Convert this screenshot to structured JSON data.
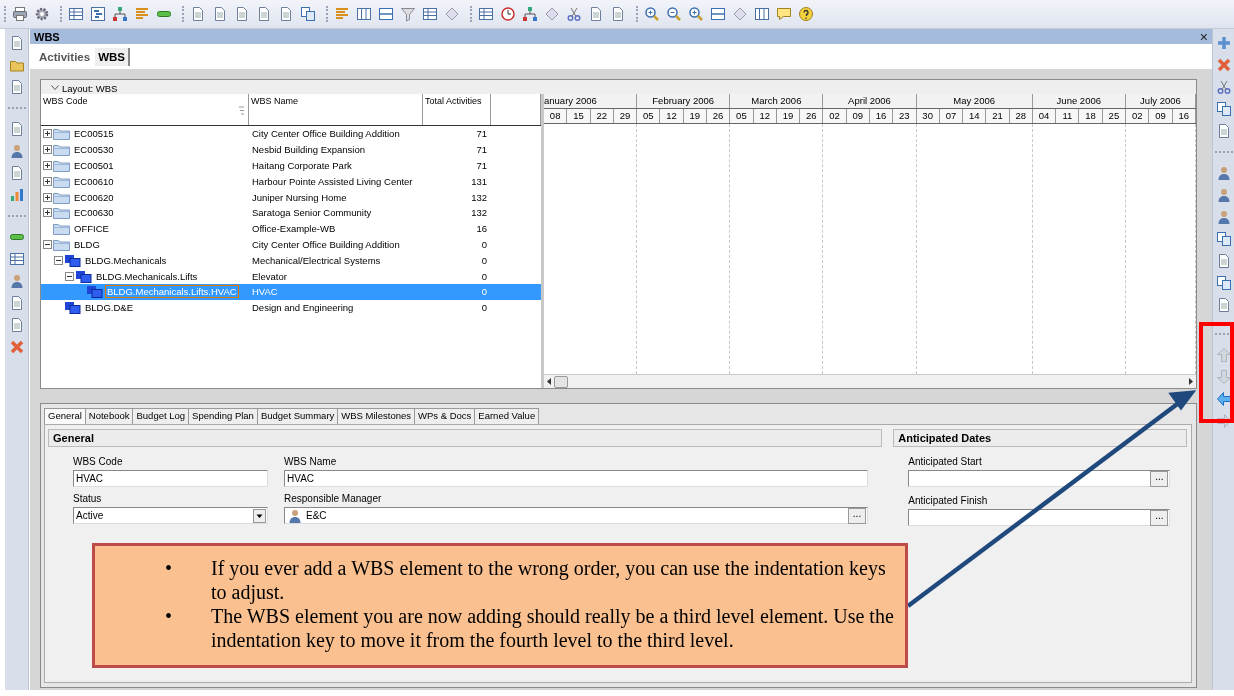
{
  "window": {
    "title": "WBS",
    "close_label": "×"
  },
  "view_tabs": [
    {
      "label": "Activities",
      "selected": false
    },
    {
      "label": "WBS",
      "selected": true
    }
  ],
  "layout": {
    "label": "Layout: WBS"
  },
  "table": {
    "columns": [
      "WBS Code",
      "WBS Name",
      "Total Activities"
    ],
    "rows": [
      {
        "code": "EC00515",
        "name": "City Center Office Building Addition",
        "total": "71",
        "kind": "folder",
        "expanded": false,
        "selected": false
      },
      {
        "code": "EC00530",
        "name": "Nesbid Building Expansion",
        "total": "71",
        "kind": "folder",
        "expanded": false,
        "selected": false
      },
      {
        "code": "EC00501",
        "name": "Haitang Corporate Park",
        "total": "71",
        "kind": "folder",
        "expanded": false,
        "selected": false
      },
      {
        "code": "EC00610",
        "name": "Harbour Pointe Assisted Living Center",
        "total": "131",
        "kind": "folder",
        "expanded": false,
        "selected": false
      },
      {
        "code": "EC00620",
        "name": "Juniper Nursing Home",
        "total": "132",
        "kind": "folder",
        "expanded": false,
        "selected": false
      },
      {
        "code": "EC00630",
        "name": "Saratoga Senior Community",
        "total": "132",
        "kind": "folder",
        "expanded": false,
        "selected": false
      },
      {
        "code": "OFFICE",
        "name": "Office-Example-WB",
        "total": "16",
        "kind": "folder",
        "selected": false
      },
      {
        "code": "BLDG",
        "name": "City Center Office Building Addition",
        "total": "0",
        "kind": "folder",
        "expanded": true,
        "selected": false,
        "children": [
          {
            "code": "BLDG.Mechanicals",
            "name": "Mechanical/Electrical Systems",
            "total": "0",
            "kind": "wbs",
            "expanded": true,
            "selected": false,
            "children": [
              {
                "code": "BLDG.Mechanicals.Lifts",
                "name": "Elevator",
                "total": "0",
                "kind": "wbs",
                "expanded": true,
                "selected": false,
                "children": [
                  {
                    "code": "BLDG.Mechanicals.Lifts.HVAC",
                    "name": "HVAC",
                    "total": "0",
                    "kind": "wbs",
                    "selected": true
                  }
                ]
              }
            ]
          },
          {
            "code": "BLDG.D&E",
            "name": "Design and Engineering",
            "total": "0",
            "kind": "wbs",
            "selected": false
          }
        ]
      }
    ]
  },
  "gantt": {
    "months": [
      {
        "label": "anuary 2006",
        "weeks": [
          "08",
          "15",
          "22",
          "29"
        ]
      },
      {
        "label": "February 2006",
        "weeks": [
          "05",
          "12",
          "19",
          "26"
        ]
      },
      {
        "label": "March 2006",
        "weeks": [
          "05",
          "12",
          "19",
          "26"
        ]
      },
      {
        "label": "April 2006",
        "weeks": [
          "02",
          "09",
          "16",
          "23"
        ]
      },
      {
        "label": "May 2006",
        "weeks": [
          "30",
          "07",
          "14",
          "21",
          "28"
        ]
      },
      {
        "label": "June 2006",
        "weeks": [
          "04",
          "11",
          "18",
          "25"
        ]
      },
      {
        "label": "July 2006",
        "weeks": [
          "02",
          "09",
          "16"
        ]
      }
    ]
  },
  "detail_tabs": [
    {
      "label": "General",
      "selected": true
    },
    {
      "label": "Notebook",
      "selected": false
    },
    {
      "label": "Budget Log",
      "selected": false
    },
    {
      "label": "Spending Plan",
      "selected": false
    },
    {
      "label": "Budget Summary",
      "selected": false
    },
    {
      "label": "WBS Milestones",
      "selected": false
    },
    {
      "label": "WPs & Docs",
      "selected": false
    },
    {
      "label": "Earned Value",
      "selected": false
    }
  ],
  "general": {
    "title": "General",
    "fields": [
      {
        "label": "WBS Code",
        "value": "HVAC",
        "kind": "text"
      },
      {
        "label": "WBS Name",
        "value": "HVAC",
        "kind": "text"
      },
      {
        "label": "Status",
        "value": "Active",
        "kind": "dropdown"
      },
      {
        "label": "Responsible Manager",
        "value": "E&C",
        "kind": "picker",
        "button": "..."
      }
    ]
  },
  "anticipated_dates": {
    "title": "Anticipated Dates",
    "fields": [
      {
        "label": "Anticipated Start",
        "kind": "date",
        "button": "..."
      },
      {
        "label": "Anticipated Finish",
        "kind": "date",
        "button": "..."
      }
    ]
  },
  "indent_tools": [
    {
      "kind": "up",
      "disabled": true
    },
    {
      "kind": "down",
      "disabled": true
    },
    {
      "kind": "left",
      "disabled": false
    },
    {
      "kind": "right",
      "disabled": true
    }
  ],
  "callout": {
    "items": [
      {
        "bullet": "•",
        "text": "If you ever add a WBS element to the wrong order, you can use the indentation keys to adjust."
      },
      {
        "bullet": "•",
        "text": "The WBS element you are now adding should really be a third level element. Use the indentation key to move it from the fourth level to the third level."
      }
    ]
  }
}
